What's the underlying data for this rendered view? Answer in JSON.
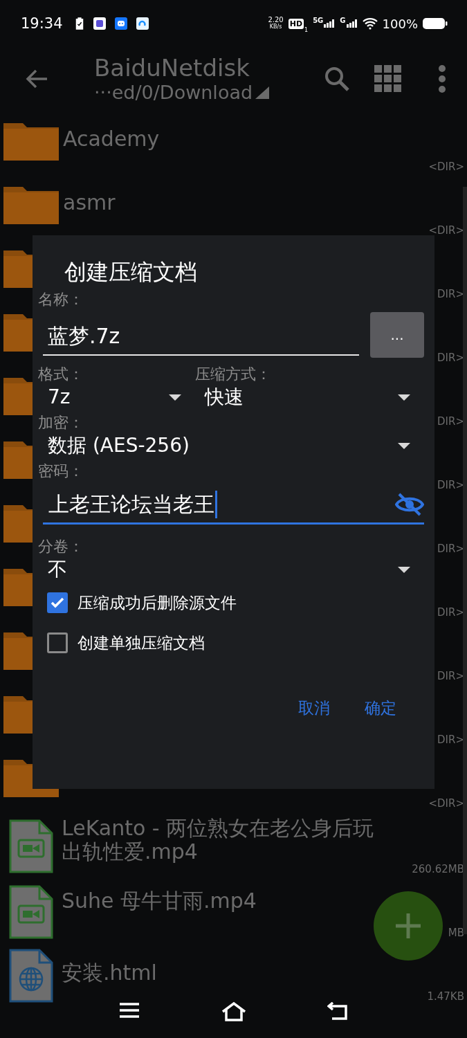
{
  "status_bar": {
    "time": "19:34",
    "speed": "2.20",
    "speed_unit": "KB/s",
    "hd": "HD",
    "hd_sub": "1",
    "network_1": "5G",
    "network_2": "G",
    "battery": "100%"
  },
  "toolbar": {
    "title": "BaiduNetdisk",
    "path": "···ed/0/Download"
  },
  "files": [
    {
      "kind": "folder",
      "name": "Academy",
      "size": "<DIR>"
    },
    {
      "kind": "folder",
      "name": "asmr",
      "size": "<DIR>"
    },
    {
      "kind": "folder",
      "size": "DIR>"
    },
    {
      "kind": "folder",
      "size": "DIR>"
    },
    {
      "kind": "folder",
      "size": "DIR>"
    },
    {
      "kind": "folder",
      "size": "DIR>"
    },
    {
      "kind": "folder",
      "size": "DIR>"
    },
    {
      "kind": "folder",
      "size": "DIR>"
    },
    {
      "kind": "folder",
      "size": "DIR>"
    },
    {
      "kind": "folder",
      "size": "DIR>"
    },
    {
      "kind": "folder",
      "size": "<DIR>"
    },
    {
      "kind": "video",
      "name": "LeKanto - 两位熟女在老公身后玩出轨性爱.mp4",
      "size": "260.62MB"
    },
    {
      "kind": "video",
      "name": "Suhe 母牛甘雨.mp4",
      "size": "MB"
    },
    {
      "kind": "web",
      "name": "安装.html",
      "size": "1.47KB"
    }
  ],
  "dialog": {
    "title": "创建压缩文档",
    "name_label": "名称：",
    "name_value": "蓝梦.7z",
    "browse_button": "...",
    "format_label": "格式：",
    "format_value": "7z",
    "method_label": "压缩方式：",
    "method_value": "快速",
    "encryption_label": "加密：",
    "encryption_value": "数据 (AES-256)",
    "password_label": "密码：",
    "password_value": "上老王论坛当老王",
    "split_label": "分卷：",
    "split_value": "不",
    "options": [
      {
        "label": "压缩成功后删除源文件",
        "checked": true
      },
      {
        "label": "创建单独压缩文档",
        "checked": false
      }
    ],
    "buttons": [
      "取消",
      "确定"
    ]
  }
}
